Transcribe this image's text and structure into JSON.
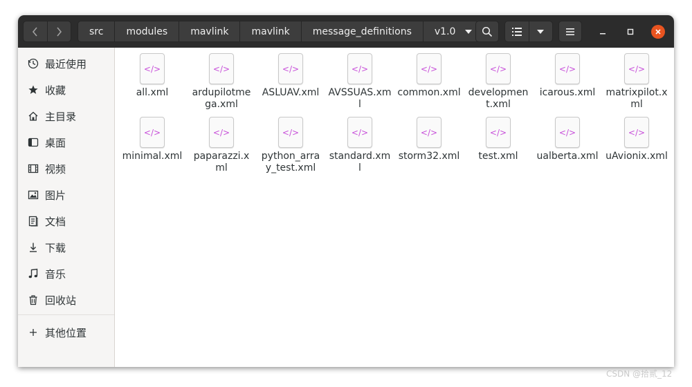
{
  "header": {
    "breadcrumbs": [
      "src",
      "modules",
      "mavlink",
      "mavlink",
      "message_definitions",
      "v1.0"
    ]
  },
  "sidebar": {
    "items": [
      {
        "label": "最近使用",
        "icon": "clock-icon"
      },
      {
        "label": "收藏",
        "icon": "star-icon"
      },
      {
        "label": "主目录",
        "icon": "home-icon"
      },
      {
        "label": "桌面",
        "icon": "desktop-icon"
      },
      {
        "label": "视频",
        "icon": "video-icon"
      },
      {
        "label": "图片",
        "icon": "picture-icon"
      },
      {
        "label": "文档",
        "icon": "document-icon"
      },
      {
        "label": "下载",
        "icon": "download-icon"
      },
      {
        "label": "音乐",
        "icon": "music-icon"
      },
      {
        "label": "回收站",
        "icon": "trash-icon"
      }
    ],
    "other": {
      "label": "其他位置",
      "icon": "plus-icon"
    }
  },
  "files": [
    "all.xml",
    "ardupilotmega.xml",
    "ASLUAV.xml",
    "AVSSUAS.xml",
    "common.xml",
    "development.xml",
    "icarous.xml",
    "matrixpilot.xml",
    "minimal.xml",
    "paparazzi.xml",
    "python_array_test.xml",
    "standard.xml",
    "storm32.xml",
    "test.xml",
    "ualberta.xml",
    "uAvionix.xml"
  ],
  "file_icon": {
    "glyph": "</>",
    "color": "#c74fd9"
  },
  "colors": {
    "header": "#2c2c2c",
    "close": "#e95420",
    "sidebar": "#f6f5f4"
  },
  "watermark": "CSDN @拾贰_12"
}
